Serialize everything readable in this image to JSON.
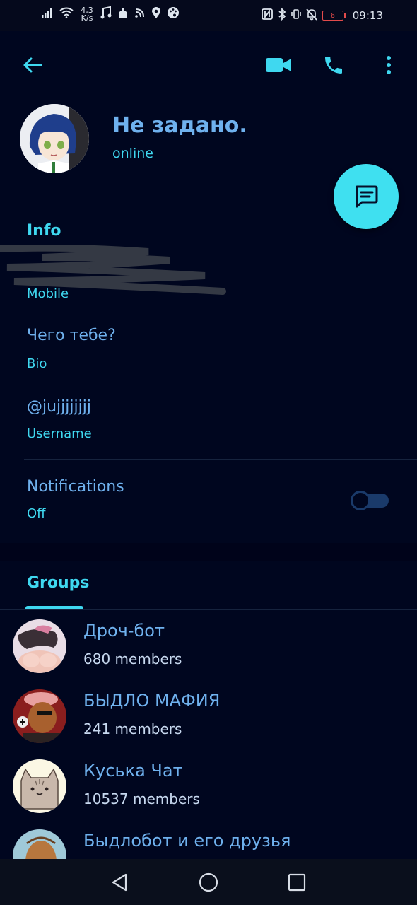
{
  "status_bar": {
    "net_speed_value": "4,3",
    "net_speed_unit": "K/s",
    "battery_level": "6",
    "time": "09:13"
  },
  "profile": {
    "name": "Не задано.",
    "status": "online"
  },
  "info": {
    "title": "Info",
    "phone_label": "Mobile",
    "bio_value": "Чего тебе?",
    "bio_label": "Bio",
    "username_value": "@jujjjjjjjj",
    "username_label": "Username",
    "notifications_value": "Notifications",
    "notifications_label": "Off"
  },
  "tabs": {
    "groups": "Groups"
  },
  "groups": [
    {
      "name": "Дроч-бот",
      "members": "680 members"
    },
    {
      "name": "БЫДЛО МАФИЯ",
      "members": "241 members"
    },
    {
      "name": "Куська Чат",
      "members": "10537 members"
    },
    {
      "name": "Быдлобот и его друзья",
      "members": ""
    }
  ],
  "colors": {
    "background": "#00061f",
    "accent": "#3fd8f0",
    "link": "#6fb1ee",
    "battery_low": "#e34b4b"
  }
}
